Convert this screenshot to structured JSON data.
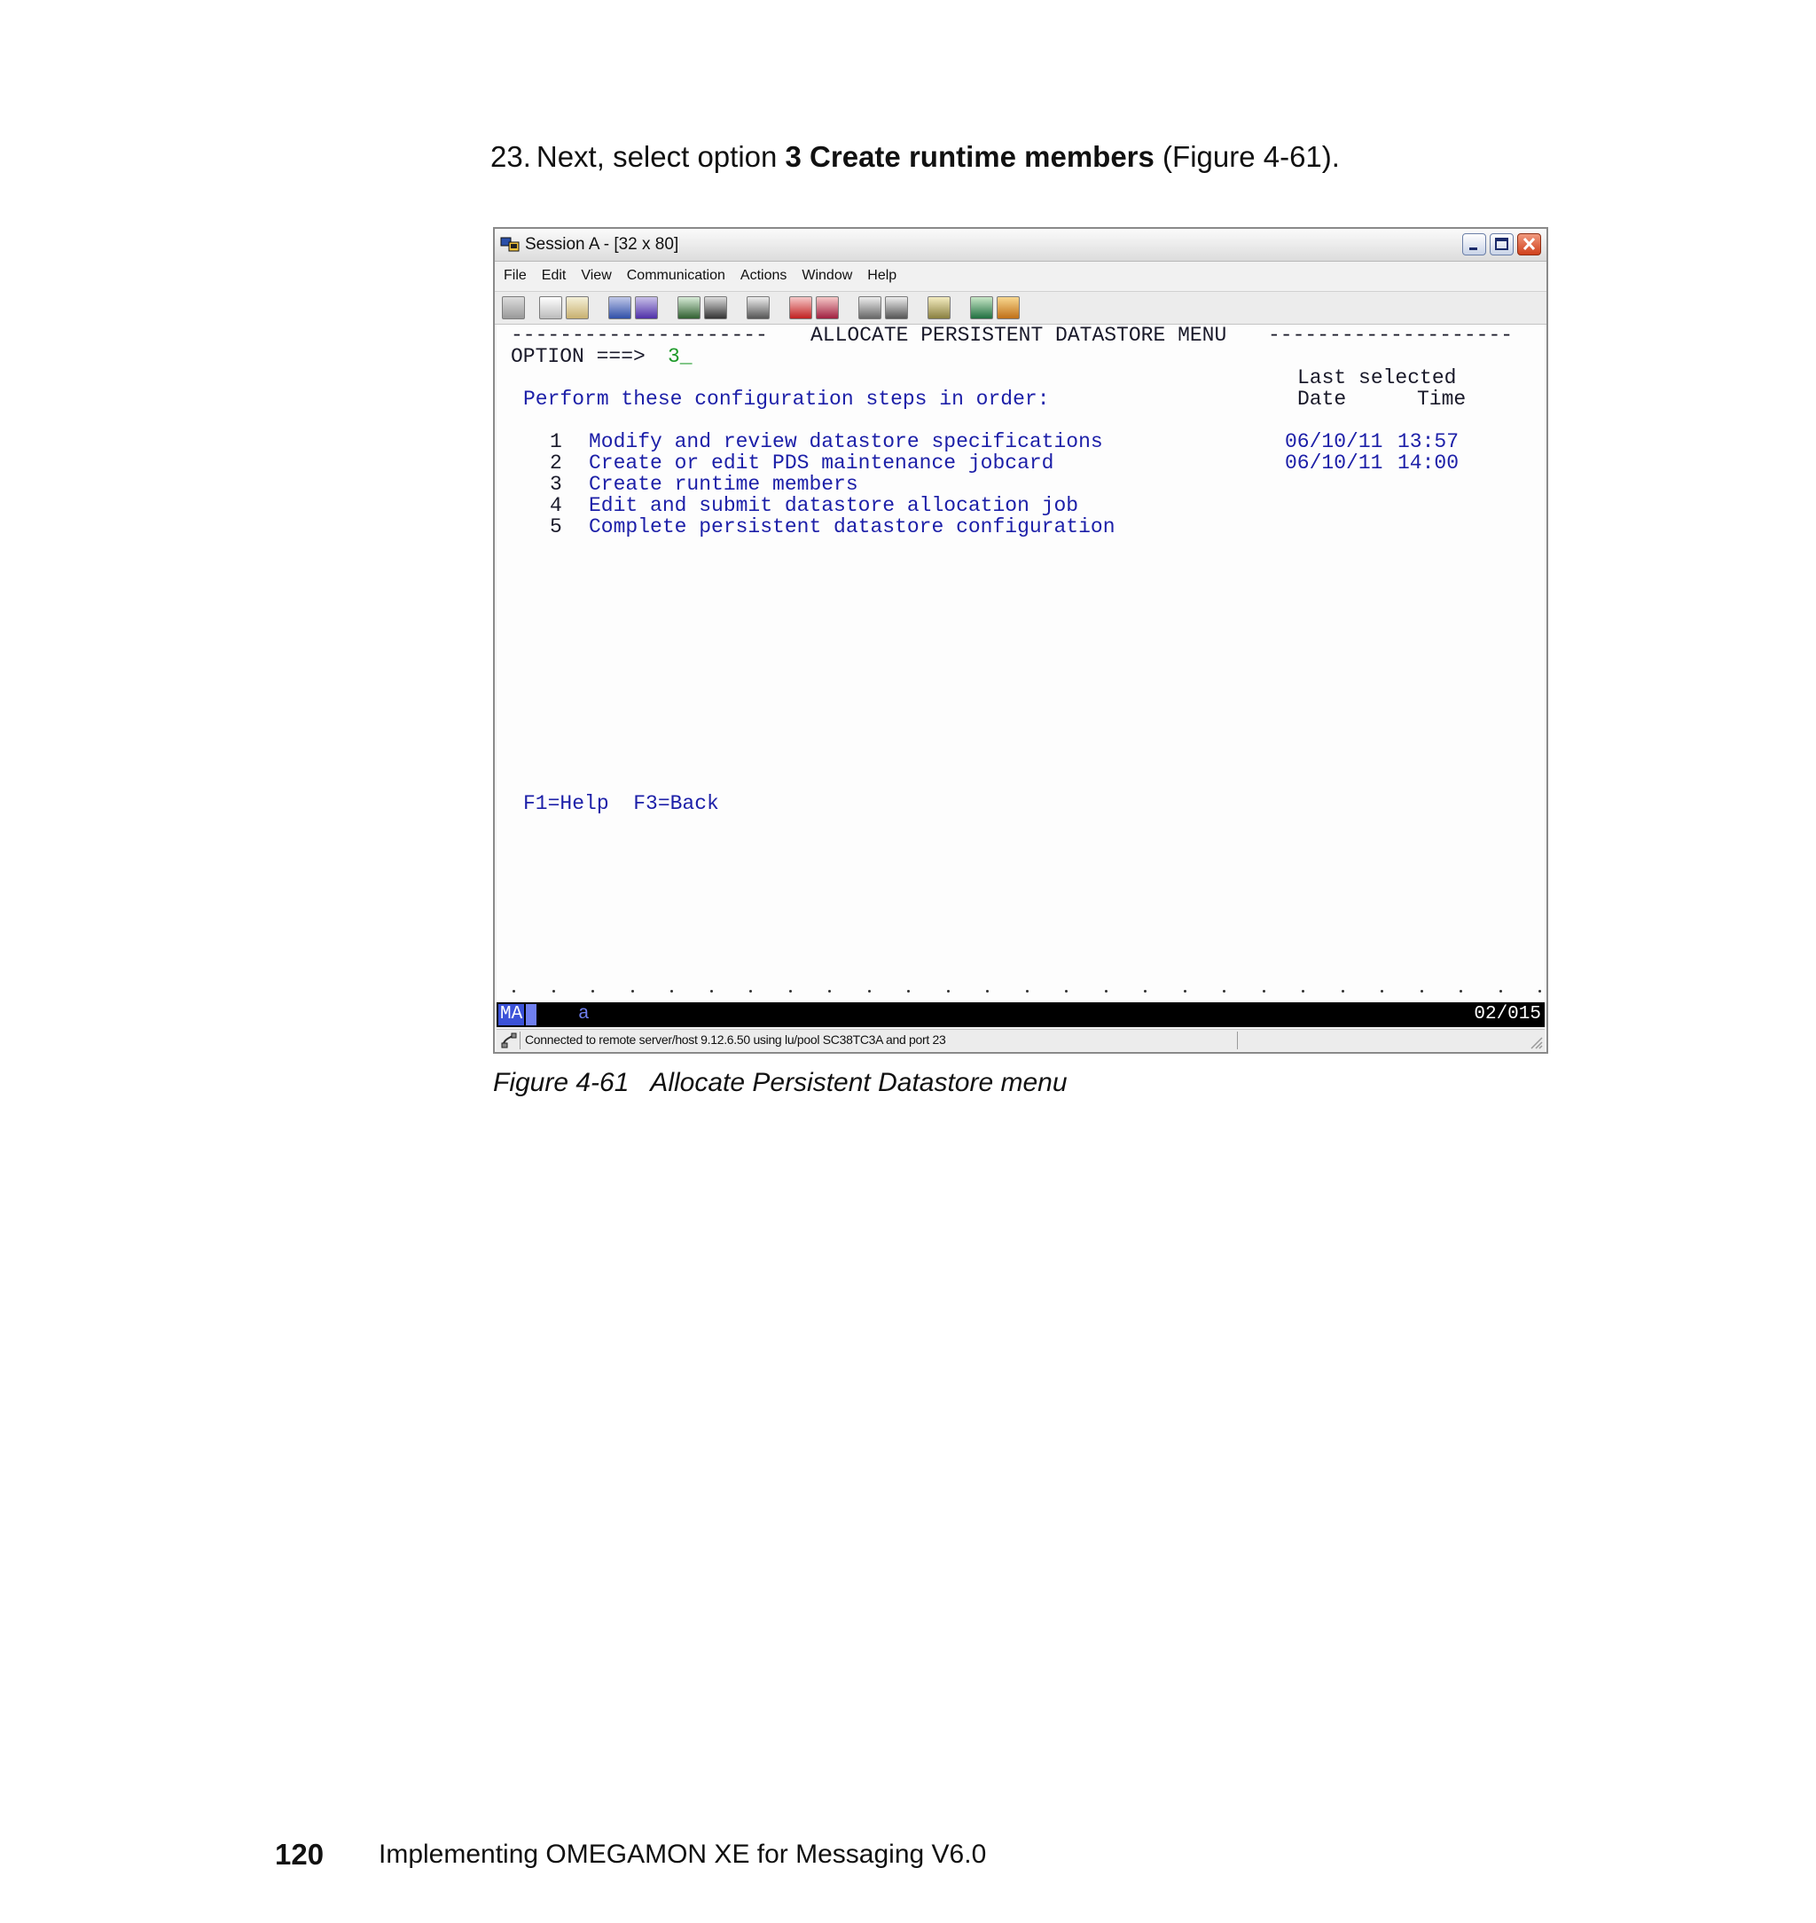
{
  "step": {
    "number": "23.",
    "pre": "Next, select option ",
    "bold": "3 Create runtime members",
    "post": " (Figure 4-61)."
  },
  "window": {
    "title": "Session A - [32 x 80]",
    "menu": [
      "File",
      "Edit",
      "View",
      "Communication",
      "Actions",
      "Window",
      "Help"
    ]
  },
  "terminal": {
    "header_dashes_left": "---------------------",
    "header_title": "ALLOCATE PERSISTENT DATASTORE MENU",
    "header_dashes_right": "--------------------",
    "option_prompt": "OPTION ===>",
    "option_value": "3_",
    "last_selected_label": "Last selected",
    "date_label": "Date",
    "time_label": "Time",
    "instructions": "Perform these configuration steps in order:",
    "items": [
      {
        "num": "1",
        "label": "Modify and review datastore specifications",
        "date": "06/10/11",
        "time": "13:57"
      },
      {
        "num": "2",
        "label": "Create or edit PDS maintenance jobcard",
        "date": "06/10/11",
        "time": "14:00"
      },
      {
        "num": "3",
        "label": "Create runtime members",
        "date": "",
        "time": ""
      },
      {
        "num": "4",
        "label": "Edit and submit datastore allocation job",
        "date": "",
        "time": ""
      },
      {
        "num": "5",
        "label": "Complete persistent datastore configuration",
        "date": "",
        "time": ""
      }
    ],
    "fkeys": "F1=Help  F3=Back"
  },
  "status": {
    "mode": "MA",
    "indicator": "a",
    "cursor_pos": "02/015"
  },
  "connection": "Connected to remote server/host 9.12.6.50 using lu/pool SC38TC3A and port 23",
  "caption": "Figure 4-61   Allocate Persistent Datastore menu",
  "footer": {
    "page_number": "120",
    "book_title": "Implementing OMEGAMON XE for Messaging V6.0"
  },
  "colors": {
    "terminal_text": "#1c1fa8",
    "option_input": "#1e9a2a",
    "status_bar": "#000000"
  }
}
